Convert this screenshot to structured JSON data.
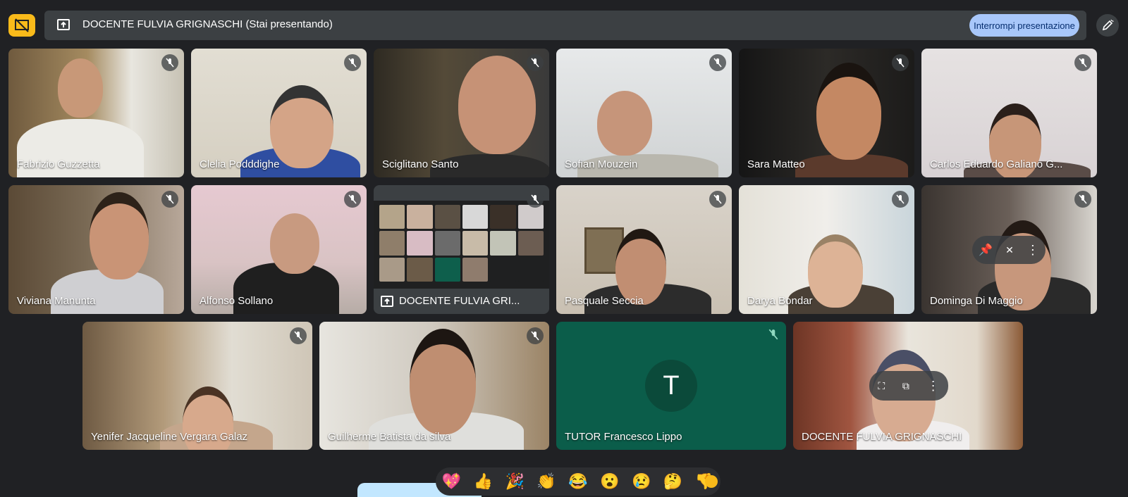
{
  "presentation": {
    "presenter": "DOCENTE FULVIA GRIGNASCHI",
    "status": "(Stai presentando)",
    "stop_label": "Interrompi presentazione"
  },
  "participants": [
    {
      "name": "Fabrizio Guzzetta",
      "muted": true
    },
    {
      "name": "Clelia Podddighe",
      "muted": true
    },
    {
      "name": "Sciglitano Santo",
      "muted": true
    },
    {
      "name": "Sofian Mouzein",
      "muted": true
    },
    {
      "name": "Sara Matteo",
      "muted": true
    },
    {
      "name": "Carlos Eduardo Galiano G...",
      "muted": true
    },
    {
      "name": "Viviana Manunta",
      "muted": true
    },
    {
      "name": "Alfonso Sollano",
      "muted": true
    },
    {
      "name": "DOCENTE FULVIA GRI...",
      "muted": true
    },
    {
      "name": "Pasquale Seccia",
      "muted": true
    },
    {
      "name": "Darya Bondar",
      "muted": true
    },
    {
      "name": "Dominga Di Maggio",
      "muted": true
    },
    {
      "name": "Yenifer Jacqueline Vergara Galaz",
      "muted": true
    },
    {
      "name": "Guilherme Batista da silva",
      "muted": true
    },
    {
      "name": "TUTOR Francesco Lippo",
      "muted": true,
      "avatar_letter": "T"
    },
    {
      "name": "DOCENTE FULVIA GRIGNASCHI",
      "muted": false
    }
  ],
  "reactions": [
    "💖",
    "👍",
    "🎉",
    "👏",
    "😂",
    "😮",
    "😢",
    "🤔",
    "👎"
  ],
  "colors": {
    "accent": "#f9ba1a",
    "stop_bg": "#a8c7fa",
    "bg": "#202124"
  }
}
